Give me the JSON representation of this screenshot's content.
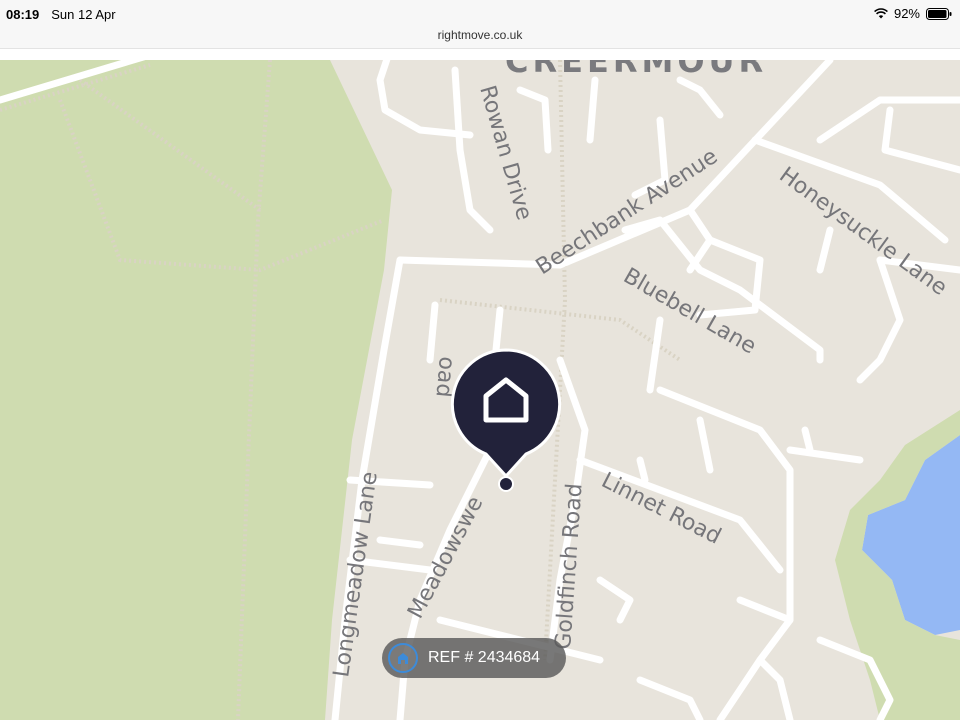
{
  "status_bar": {
    "time": "08:19",
    "date": "Sun 12 Apr",
    "battery": "92%"
  },
  "browser": {
    "url": "rightmove.co.uk"
  },
  "map": {
    "area_label": "CREERMOUR",
    "streets": {
      "rowan_drive": "Rowan Drive",
      "beechbank_avenue": "Beechbank Avenue",
      "honeysuckle_lane": "Honeysuckle Lane",
      "bluebell_lane": "Bluebell Lane",
      "road_fragment": "oad",
      "meadowsweet": "Meadowswe",
      "goldfinch_road": "Goldfinch Road",
      "linnet_road": "Linnet Road",
      "longmeadow_lane": "Longmeadow Lane"
    },
    "colors": {
      "park": "#cfdcb0",
      "land": "#e8e4dc",
      "road": "#ffffff",
      "water": "#94b8f4",
      "pin": "#22223a"
    }
  },
  "reference": {
    "label": "REF # 2434684"
  }
}
